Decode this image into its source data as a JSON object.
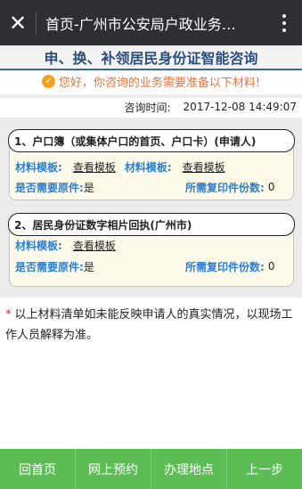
{
  "topbar": {
    "title": "首页-广州市公安局户政业务…"
  },
  "heading": "申、换、补领居民身份证智能咨询",
  "notice": "您好，你咨询的业务需要准备以下材料!",
  "query_time": {
    "label": "咨询时间:",
    "value": "2017-12-08 14:49:07"
  },
  "materials": [
    {
      "title": "1、户口簿（或集体户口的首页、户口卡）(申请人)",
      "template_label_1": "材料模板:",
      "template_link_1": "查看模板",
      "template_label_2": "材料模板:",
      "template_link_2": "查看模板",
      "original_label": "是否需要原件:",
      "original_value": "是",
      "copies_label": "所需复印件份数:",
      "copies_value": "0"
    },
    {
      "title": "2、居民身份证数字相片回执(广州市)",
      "template_label_1": "材料模板:",
      "template_link_1": "查看模板",
      "original_label": "是否需要原件:",
      "original_value": "是",
      "copies_label": "所需复印件份数:",
      "copies_value": "0"
    }
  ],
  "footnote": "以上材料清单如未能反映申请人的真实情况，以现场工作人员解释为准。",
  "bottom_nav": [
    "回首页",
    "网上预约",
    "办理地点",
    "上一步"
  ]
}
